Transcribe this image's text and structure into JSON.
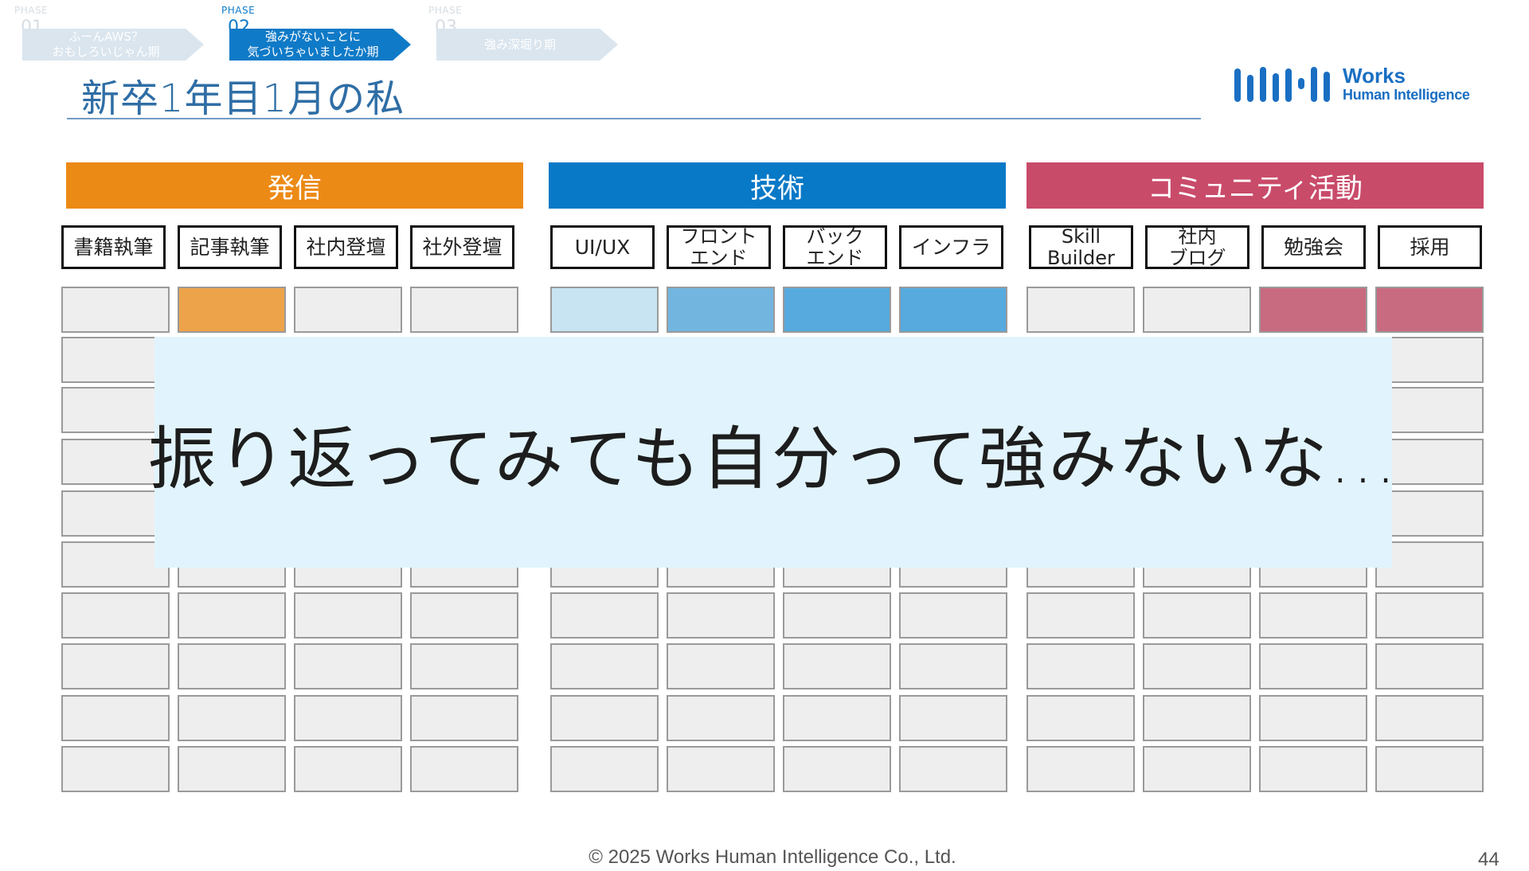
{
  "phases": [
    {
      "label": "PHASE",
      "number": "01",
      "text": "ふーんAWS？\nおもしろいじゃん期",
      "state": "dim"
    },
    {
      "label": "PHASE",
      "number": "02",
      "text": "強みがないことに\n気づいちゃいましたか期",
      "state": "active"
    },
    {
      "label": "PHASE",
      "number": "03",
      "text": "強み深堀り期",
      "state": "dim"
    }
  ],
  "page_title": "新卒1年目1月の私",
  "logo": {
    "line1": "Works",
    "line2": "Human Intelligence"
  },
  "categories": [
    {
      "name": "発信",
      "color": "#ec8a16"
    },
    {
      "name": "技術",
      "color": "#0879c7"
    },
    {
      "name": "コミュニティ活動",
      "color": "#c94b6a"
    }
  ],
  "subcategories": [
    [
      "書籍執筆",
      "記事執筆",
      "社内登壇",
      "社外登壇"
    ],
    [
      "UI/UX",
      "フロント\nエンド",
      "バック\nエンド",
      "インフラ"
    ],
    [
      "Skill\nBuilder",
      "社内\nブログ",
      "勉強会",
      "採用"
    ]
  ],
  "first_row_fills": [
    [
      "#eeeeee",
      "#eda34a",
      "#eeeeee",
      "#eeeeee"
    ],
    [
      "#c8e3f2",
      "#72b6e0",
      "#56aade",
      "#56aade"
    ],
    [
      "#eeeeee",
      "#eeeeee",
      "#c86a80",
      "#c86a80"
    ]
  ],
  "overlay_message": "振り返ってみても自分って強みないな…",
  "footer": "© 2025 Works Human Intelligence Co., Ltd.",
  "page_number": "44",
  "colors": {
    "title": "#2f6ea5",
    "overlay_bg": "#e1f4fd",
    "empty_cell": "#eeeeee"
  }
}
